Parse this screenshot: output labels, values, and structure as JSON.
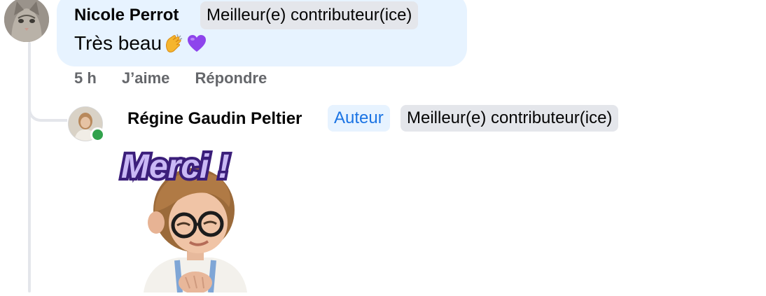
{
  "comment": {
    "author": "Nicole Perrot",
    "badge": "Meilleur(e) contributeur(ice)",
    "text": "Très beau",
    "emojis": [
      "clapping-hands",
      "purple-heart"
    ],
    "time": "5 h",
    "like_label": "J’aime",
    "reply_label": "Répondre"
  },
  "reply": {
    "author": "Régine Gaudin Peltier",
    "author_badge": "Auteur",
    "badge": "Meilleur(e) contributeur(ice)",
    "sticker_text": "Merci !"
  },
  "colors": {
    "bubble": "#e7f3ff",
    "badge_bg": "#e4e6eb",
    "author_badge_text": "#1b74e4",
    "online": "#31a24c",
    "sticker_purple": "#7b4fd6"
  }
}
